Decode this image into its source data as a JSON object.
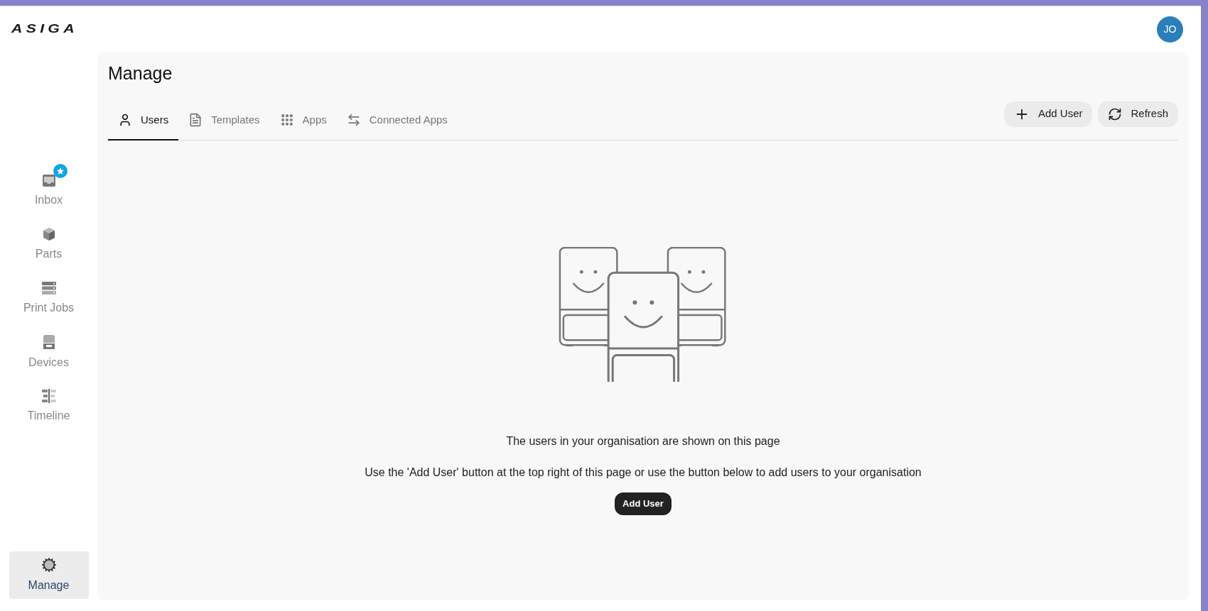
{
  "logo": "ASIGA",
  "avatar": "JO",
  "sidebar": {
    "items": [
      {
        "label": "Inbox",
        "kind": "inbox",
        "badge": true,
        "selected": false
      },
      {
        "label": "Parts",
        "kind": "parts",
        "badge": false,
        "selected": false
      },
      {
        "label": "Print Jobs",
        "kind": "jobs",
        "badge": false,
        "selected": false
      },
      {
        "label": "Devices",
        "kind": "devices",
        "badge": false,
        "selected": false
      },
      {
        "label": "Timeline",
        "kind": "timeline",
        "badge": false,
        "selected": false
      },
      {
        "label": "Manage",
        "kind": "manage",
        "badge": false,
        "selected": true
      }
    ]
  },
  "page": {
    "title": "Manage",
    "tabs": [
      {
        "label": "Users",
        "kind": "users",
        "selected": true
      },
      {
        "label": "Templates",
        "kind": "templates",
        "selected": false
      },
      {
        "label": "Apps",
        "kind": "apps",
        "selected": false
      },
      {
        "label": "Connected Apps",
        "kind": "connected",
        "selected": false
      }
    ],
    "actions": [
      {
        "label": "Add User",
        "kind": "add"
      },
      {
        "label": "Refresh",
        "kind": "refresh"
      }
    ]
  },
  "empty_state": {
    "heading": "The users in your organisation are shown on this page",
    "hint": "Use the 'Add User' button at the top right of this page or use the button below to add users to your organisation",
    "button": "Add User"
  }
}
